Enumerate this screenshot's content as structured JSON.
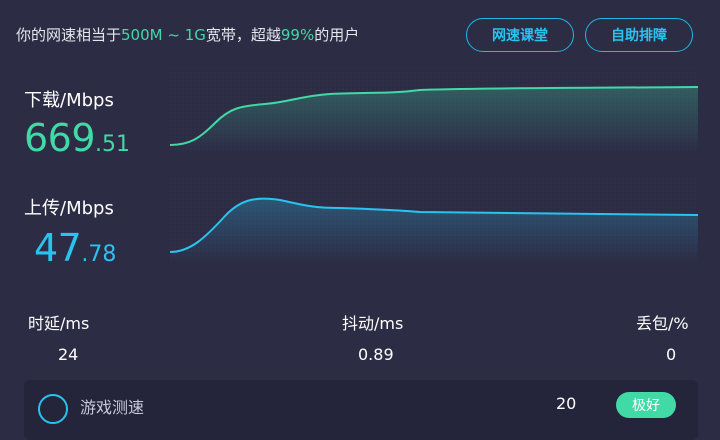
{
  "summary": {
    "prefix": "你的网速相当于",
    "range": "500M ~ 1G",
    "middle": "宽带，超越",
    "percent": "99%",
    "suffix": "的用户"
  },
  "buttons": {
    "course": "网速课堂",
    "help": "自助排障"
  },
  "download": {
    "label": "下载/Mbps",
    "value_int": "669",
    "value_dec": ".51"
  },
  "upload": {
    "label": "上传/Mbps",
    "value_int": "47",
    "value_dec": ".78"
  },
  "stats": {
    "latency_label": "时延/ms",
    "latency_value": "24",
    "jitter_label": "抖动/ms",
    "jitter_value": "0.89",
    "loss_label": "丢包/%",
    "loss_value": "0"
  },
  "game": {
    "label": "游戏测速",
    "value": "20",
    "button": "极好"
  },
  "colors": {
    "background": "#2c2c45",
    "download_accent": "#41d9a6",
    "upload_accent": "#29c3f0"
  }
}
